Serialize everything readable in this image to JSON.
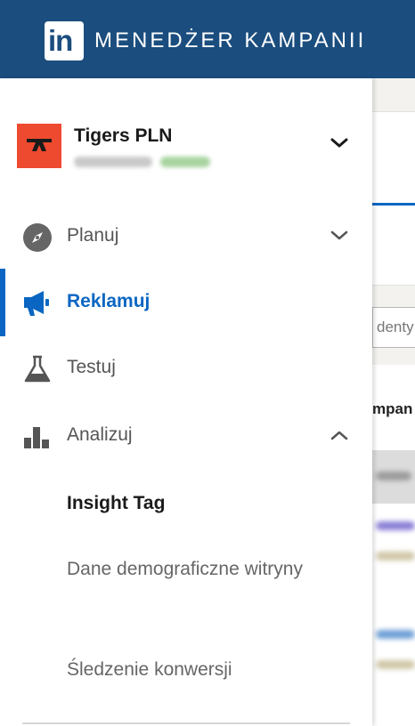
{
  "header": {
    "logo_text": "in",
    "product_title": "MENEDŻER KAMPANII",
    "background_color": "#1b4d7e"
  },
  "account": {
    "name": "Tigers PLN",
    "logo_color": "#ee4a2f"
  },
  "nav": {
    "items": [
      {
        "label": "Planuj",
        "icon": "compass-icon",
        "expanded": false
      },
      {
        "label": "Reklamuj",
        "icon": "megaphone-icon",
        "active": true
      },
      {
        "label": "Testuj",
        "icon": "flask-icon"
      },
      {
        "label": "Analizuj",
        "icon": "bar-chart-icon",
        "expanded": true
      }
    ],
    "analyze_subitems": [
      {
        "label": "Insight Tag",
        "current": true
      },
      {
        "label": "Dane demograficzne witryny"
      },
      {
        "label": "Śledzenie konwersji"
      }
    ]
  },
  "background": {
    "search_placeholder_fragment": "denty",
    "column_header_fragment": "mpan"
  },
  "colors": {
    "accent": "#0a66c2",
    "text_primary": "#1a1a1a",
    "text_secondary": "#555555"
  }
}
